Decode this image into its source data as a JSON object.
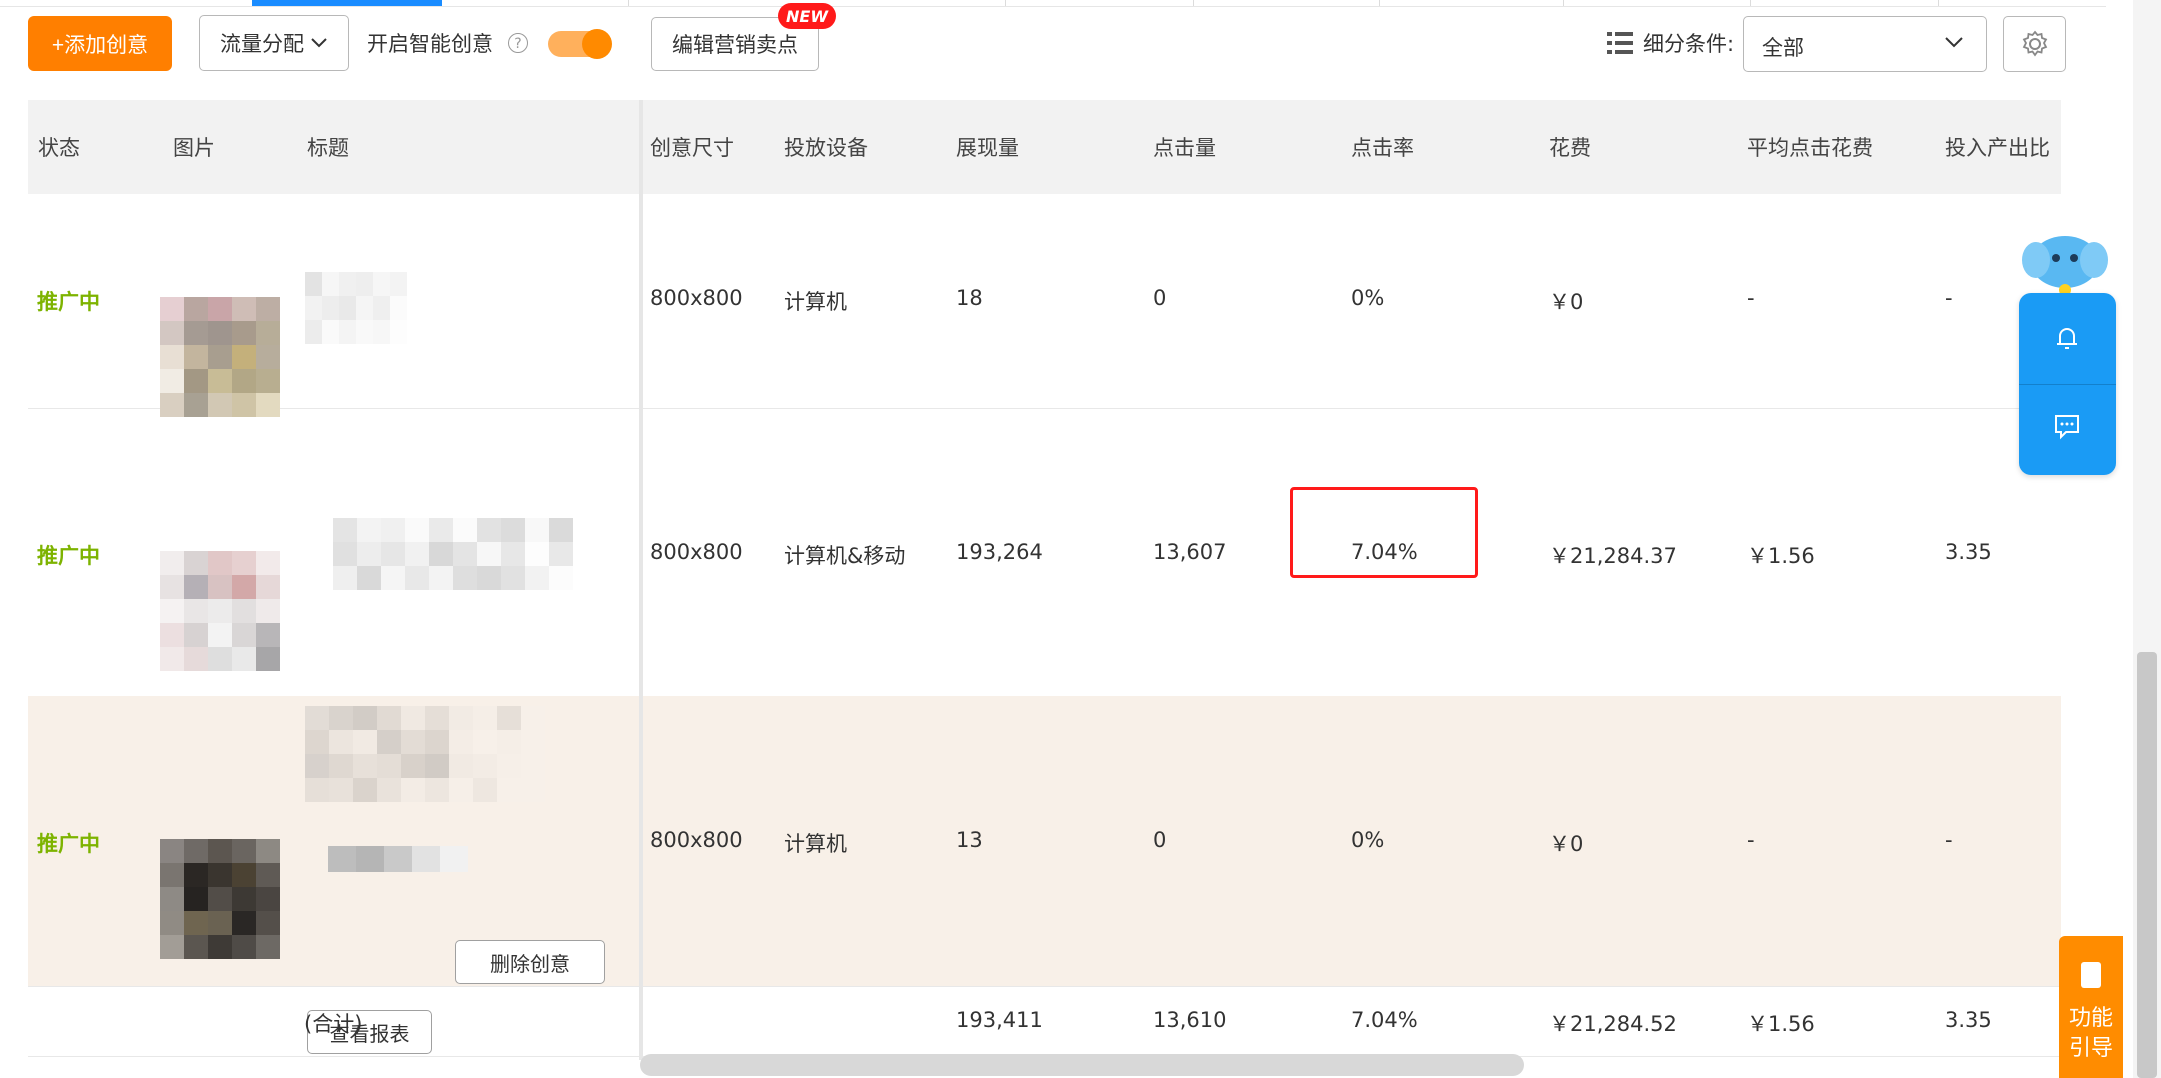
{
  "toolbar": {
    "add_label": "+添加创意",
    "flow_label": "流量分配",
    "smart_label": "开启智能创意",
    "smart_enabled": true,
    "edit_label": "编辑营销卖点",
    "new_badge": "NEW",
    "segment_label": "细分条件:",
    "segment_value": "全部"
  },
  "table": {
    "headers": [
      "状态",
      "图片",
      "标题",
      "创意尺寸",
      "投放设备",
      "展现量",
      "点击量",
      "点击率",
      "花费",
      "平均点击花费",
      "投入产出比"
    ],
    "rows": [
      {
        "status": "推广中",
        "size": "800x800",
        "device": "计算机",
        "impressions": "18",
        "clicks": "0",
        "ctr": "0%",
        "cost": "￥0",
        "cpc": "-",
        "roi": "-"
      },
      {
        "status": "推广中",
        "size": "800x800",
        "device": "计算机&移动",
        "impressions": "193,264",
        "clicks": "13,607",
        "ctr": "7.04%",
        "cost": "￥21,284.37",
        "cpc": "￥1.56",
        "roi": "3.35"
      },
      {
        "status": "推广中",
        "size": "800x800",
        "device": "计算机",
        "impressions": "13",
        "clicks": "0",
        "ctr": "0%",
        "cost": "￥0",
        "cpc": "-",
        "roi": "-"
      }
    ],
    "row_actions": {
      "delete": "删除创意",
      "report": "查看报表"
    },
    "total": {
      "label": "(合计)",
      "impressions": "193,411",
      "clicks": "13,610",
      "ctr": "7.04%",
      "cost": "￥21,284.52",
      "cpc": "￥1.56",
      "roi": "3.35"
    }
  },
  "float": {
    "guide_label": "功能引导"
  },
  "colors": {
    "accent": "#ff7f00",
    "status": "#7db300",
    "highlight_box": "#ff1a1a",
    "float_panel": "#1a9bf5",
    "selected_row": "#f8f0e8"
  }
}
